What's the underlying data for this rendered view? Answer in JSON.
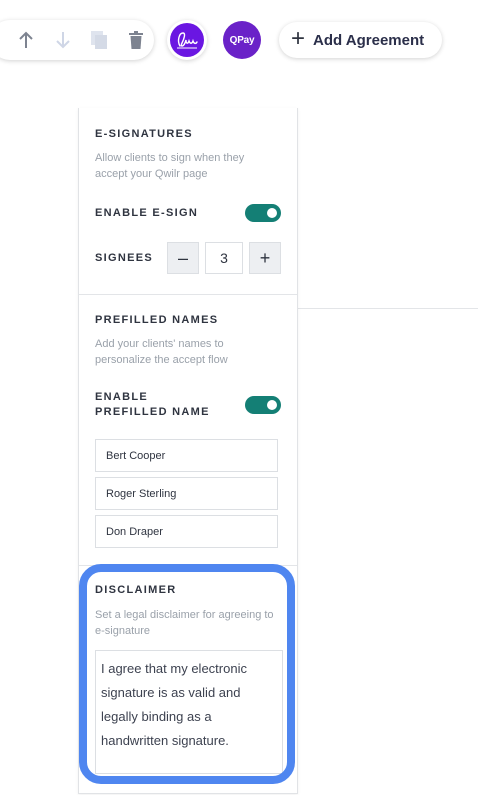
{
  "toolbar": {
    "icons": [
      "arrow-up-icon",
      "arrow-down-icon",
      "copy-icon",
      "trash-icon"
    ],
    "esign_icon": "signature-icon",
    "qpay_label": "QPay",
    "add_agreement_label": "Add Agreement",
    "accent_colors": {
      "esign": "#6a16e2",
      "qpay": "#6a22c8",
      "toggle": "#147f75",
      "highlight": "#4f86f0"
    }
  },
  "esignatures": {
    "title": "E-SIGNATURES",
    "description": "Allow clients to sign when they accept your Qwilr page",
    "enable_label": "ENABLE E-SIGN",
    "enable_on": true,
    "signees_label": "SIGNEES",
    "signees_value": "3",
    "minus_label": "–",
    "plus_label": "+"
  },
  "prefilled": {
    "title": "PREFILLED NAMES",
    "description": "Add your clients' names to personalize the accept flow",
    "enable_label": "ENABLE PREFILLED NAME",
    "enable_on": true,
    "names": [
      "Bert Cooper",
      "Roger Sterling",
      "Don Draper"
    ]
  },
  "disclaimer": {
    "title": "DISCLAIMER",
    "description": "Set a legal disclaimer for agreeing to e-signature",
    "text": "I agree that my electronic signature is as valid and legally binding as a handwritten signature."
  }
}
